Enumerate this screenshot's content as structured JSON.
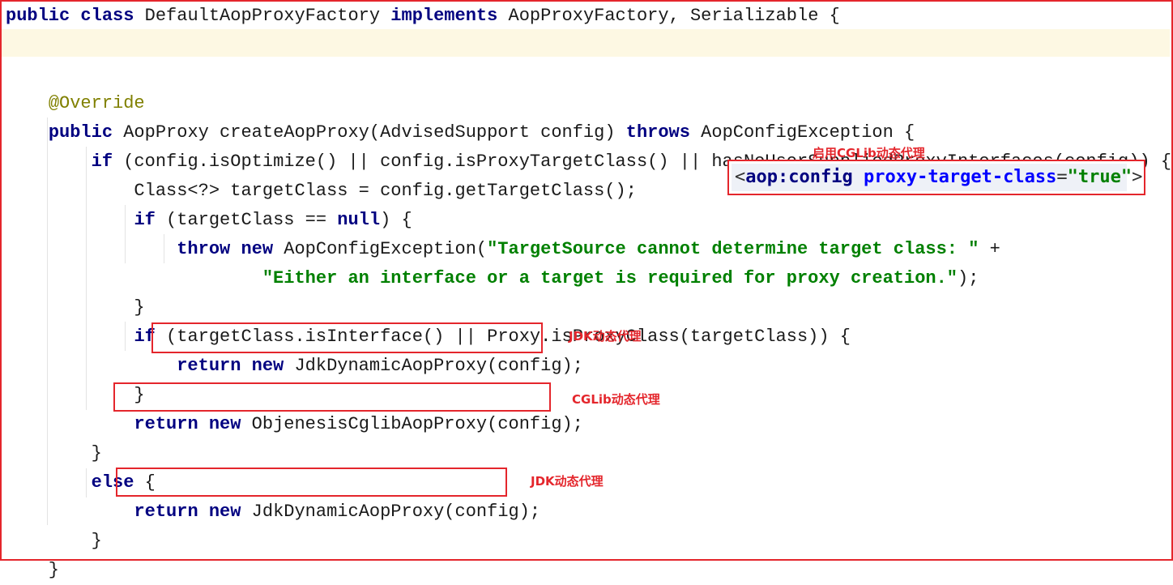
{
  "code_lines": [
    [
      {
        "t": "public class ",
        "c": "kw"
      },
      {
        "t": "DefaultAopProxyFactory ",
        "c": ""
      },
      {
        "t": "implements ",
        "c": "kw"
      },
      {
        "t": "AopProxyFactory, Serializable {",
        "c": ""
      }
    ],
    [],
    [],
    [
      {
        "t": "    ",
        "c": ""
      },
      {
        "t": "@Override",
        "c": "ann"
      }
    ],
    [
      {
        "t": "    ",
        "c": ""
      },
      {
        "t": "public ",
        "c": "kw"
      },
      {
        "t": "AopProxy createAopProxy(AdvisedSupport config) ",
        "c": ""
      },
      {
        "t": "throws ",
        "c": "kw"
      },
      {
        "t": "AopConfigException {",
        "c": ""
      }
    ],
    [
      {
        "t": "        ",
        "c": ""
      },
      {
        "t": "if ",
        "c": "kw"
      },
      {
        "t": "(config.isOptimize() || config.isProxyTargetClass() || hasNoUserSuppliedProxyInterfaces(config)) {",
        "c": ""
      }
    ],
    [
      {
        "t": "            Class<?> targetClass = config.getTargetClass();",
        "c": ""
      }
    ],
    [
      {
        "t": "            ",
        "c": ""
      },
      {
        "t": "if ",
        "c": "kw"
      },
      {
        "t": "(targetClass == ",
        "c": ""
      },
      {
        "t": "null",
        "c": "kw"
      },
      {
        "t": ") {",
        "c": ""
      }
    ],
    [
      {
        "t": "                ",
        "c": ""
      },
      {
        "t": "throw new ",
        "c": "kw"
      },
      {
        "t": "AopConfigException(",
        "c": ""
      },
      {
        "t": "\"TargetSource cannot determine target class: \"",
        "c": "str"
      },
      {
        "t": " +",
        "c": ""
      }
    ],
    [
      {
        "t": "                        ",
        "c": ""
      },
      {
        "t": "\"Either an interface or a target is required for proxy creation.\"",
        "c": "str"
      },
      {
        "t": ");",
        "c": ""
      }
    ],
    [
      {
        "t": "            }",
        "c": ""
      }
    ],
    [
      {
        "t": "            ",
        "c": ""
      },
      {
        "t": "if ",
        "c": "kw"
      },
      {
        "t": "(targetClass.isInterface() || Proxy.isProxyClass(targetClass)) {",
        "c": ""
      }
    ],
    [
      {
        "t": "                ",
        "c": ""
      },
      {
        "t": "return new ",
        "c": "kw"
      },
      {
        "t": "JdkDynamicAopProxy(config);",
        "c": ""
      }
    ],
    [
      {
        "t": "            }",
        "c": ""
      }
    ],
    [
      {
        "t": "            ",
        "c": ""
      },
      {
        "t": "return new ",
        "c": "kw"
      },
      {
        "t": "ObjenesisCglibAopProxy(config);",
        "c": ""
      }
    ],
    [
      {
        "t": "        }",
        "c": ""
      }
    ],
    [
      {
        "t": "        ",
        "c": ""
      },
      {
        "t": "else ",
        "c": "kw"
      },
      {
        "t": "{",
        "c": ""
      }
    ],
    [
      {
        "t": "            ",
        "c": ""
      },
      {
        "t": "return new ",
        "c": "kw"
      },
      {
        "t": "JdkDynamicAopProxy(config);",
        "c": ""
      }
    ],
    [
      {
        "t": "        }",
        "c": ""
      }
    ],
    [
      {
        "t": "    }",
        "c": ""
      }
    ]
  ],
  "xml_snippet": {
    "open": "<",
    "tag": "aop:config",
    "attr": " proxy-target-class",
    "eq": "=",
    "value": "\"true\"",
    "close": ">"
  },
  "annotations": {
    "enable_cglib": "启用CGLib动态代理",
    "jdk_proxy_1": "JDK动态代理",
    "cglib_proxy": "CGLib动态代理",
    "jdk_proxy_2": "JDK动态代理"
  },
  "colors": {
    "keyword": "#000080",
    "annotation": "#808000",
    "string": "#008000",
    "highlight_box": "#e4262c",
    "current_line": "#fdf8e3"
  }
}
